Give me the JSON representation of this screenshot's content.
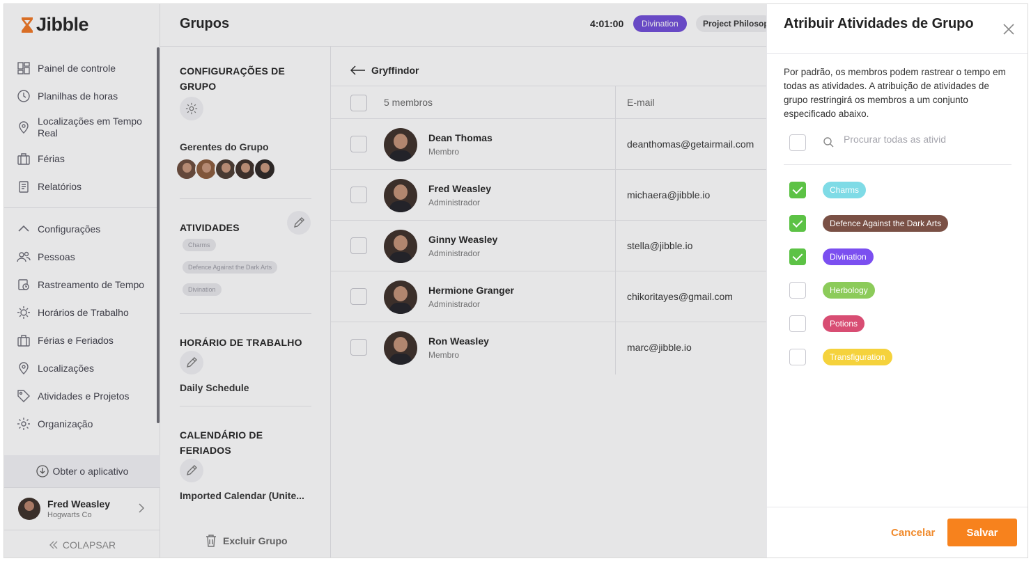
{
  "app": {
    "brand": "Jibble"
  },
  "sidebar": {
    "items": [
      {
        "label": "Painel de controle",
        "icon": "dashboard-icon"
      },
      {
        "label": "Planilhas de horas",
        "icon": "clock-icon"
      },
      {
        "label": "Localizações em Tempo Real",
        "icon": "location-pin-icon"
      },
      {
        "label": "Férias",
        "icon": "suitcase-icon"
      },
      {
        "label": "Relatórios",
        "icon": "report-icon"
      }
    ],
    "settings_label": "Configurações",
    "settings_items": [
      {
        "label": "Pessoas",
        "icon": "people-icon"
      },
      {
        "label": "Rastreamento de Tempo",
        "icon": "time-tracking-icon"
      },
      {
        "label": "Horários de Trabalho",
        "icon": "work-schedule-icon"
      },
      {
        "label": "Férias e Feriados",
        "icon": "holidays-icon"
      },
      {
        "label": "Localizações",
        "icon": "location-icon"
      },
      {
        "label": "Atividades e Projetos",
        "icon": "tag-icon"
      },
      {
        "label": "Organização",
        "icon": "gear-icon"
      }
    ],
    "get_app": "Obter o aplicativo",
    "user": {
      "name": "Fred Weasley",
      "org": "Hogwarts Co"
    },
    "collapse": "COLAPSAR"
  },
  "header": {
    "title": "Grupos",
    "timer": "4:01:00",
    "activity_chip": "Divination",
    "project_chip": "Project Philosop"
  },
  "group_settings": {
    "config_title": "CONFIGURAÇÕES DE GRUPO",
    "managers_title": "Gerentes do Grupo",
    "activities_title": "ATIVIDADES",
    "activities": [
      "Charms",
      "Defence Against the Dark Arts",
      "Divination"
    ],
    "schedule_title": "HORÁRIO DE TRABALHO",
    "schedule_value": "Daily Schedule",
    "calendar_title": "CALENDÁRIO DE FERIADOS",
    "calendar_value": "Imported Calendar (Unite...",
    "delete_label": "Excluir Grupo"
  },
  "members": {
    "group_name": "Gryffindor",
    "count_label": "5 membros",
    "email_header": "E-mail",
    "rows": [
      {
        "name": "Dean Thomas",
        "role": "Membro",
        "email": "deanthomas@getairmail.com"
      },
      {
        "name": "Fred Weasley",
        "role": "Administrador",
        "email": "michaera@jibble.io"
      },
      {
        "name": "Ginny Weasley",
        "role": "Administrador",
        "email": "stella@jibble.io"
      },
      {
        "name": "Hermione Granger",
        "role": "Administrador",
        "email": "chikoritayes@gmail.com"
      },
      {
        "name": "Ron Weasley",
        "role": "Membro",
        "email": "marc@jibble.io"
      }
    ]
  },
  "panel": {
    "title": "Atribuir Atividades de Grupo",
    "description": "Por padrão, os membros podem rastrear o tempo em todas as atividades. A atribuição de atividades de grupo restringirá os membros a um conjunto especificado abaixo.",
    "search_placeholder": "Procurar todas as ativid",
    "activities": [
      {
        "label": "Charms",
        "color": "#7fdbe6",
        "checked": true
      },
      {
        "label": "Defence Against the Dark Arts",
        "color": "#7a5045",
        "checked": true
      },
      {
        "label": "Divination",
        "color": "#7b4ff0",
        "checked": true
      },
      {
        "label": "Herbology",
        "color": "#8ccb5a",
        "checked": false
      },
      {
        "label": "Potions",
        "color": "#d84d73",
        "checked": false
      },
      {
        "label": "Transfiguration",
        "color": "#f5d23c",
        "checked": false
      }
    ],
    "cancel_label": "Cancelar",
    "save_label": "Salvar"
  }
}
